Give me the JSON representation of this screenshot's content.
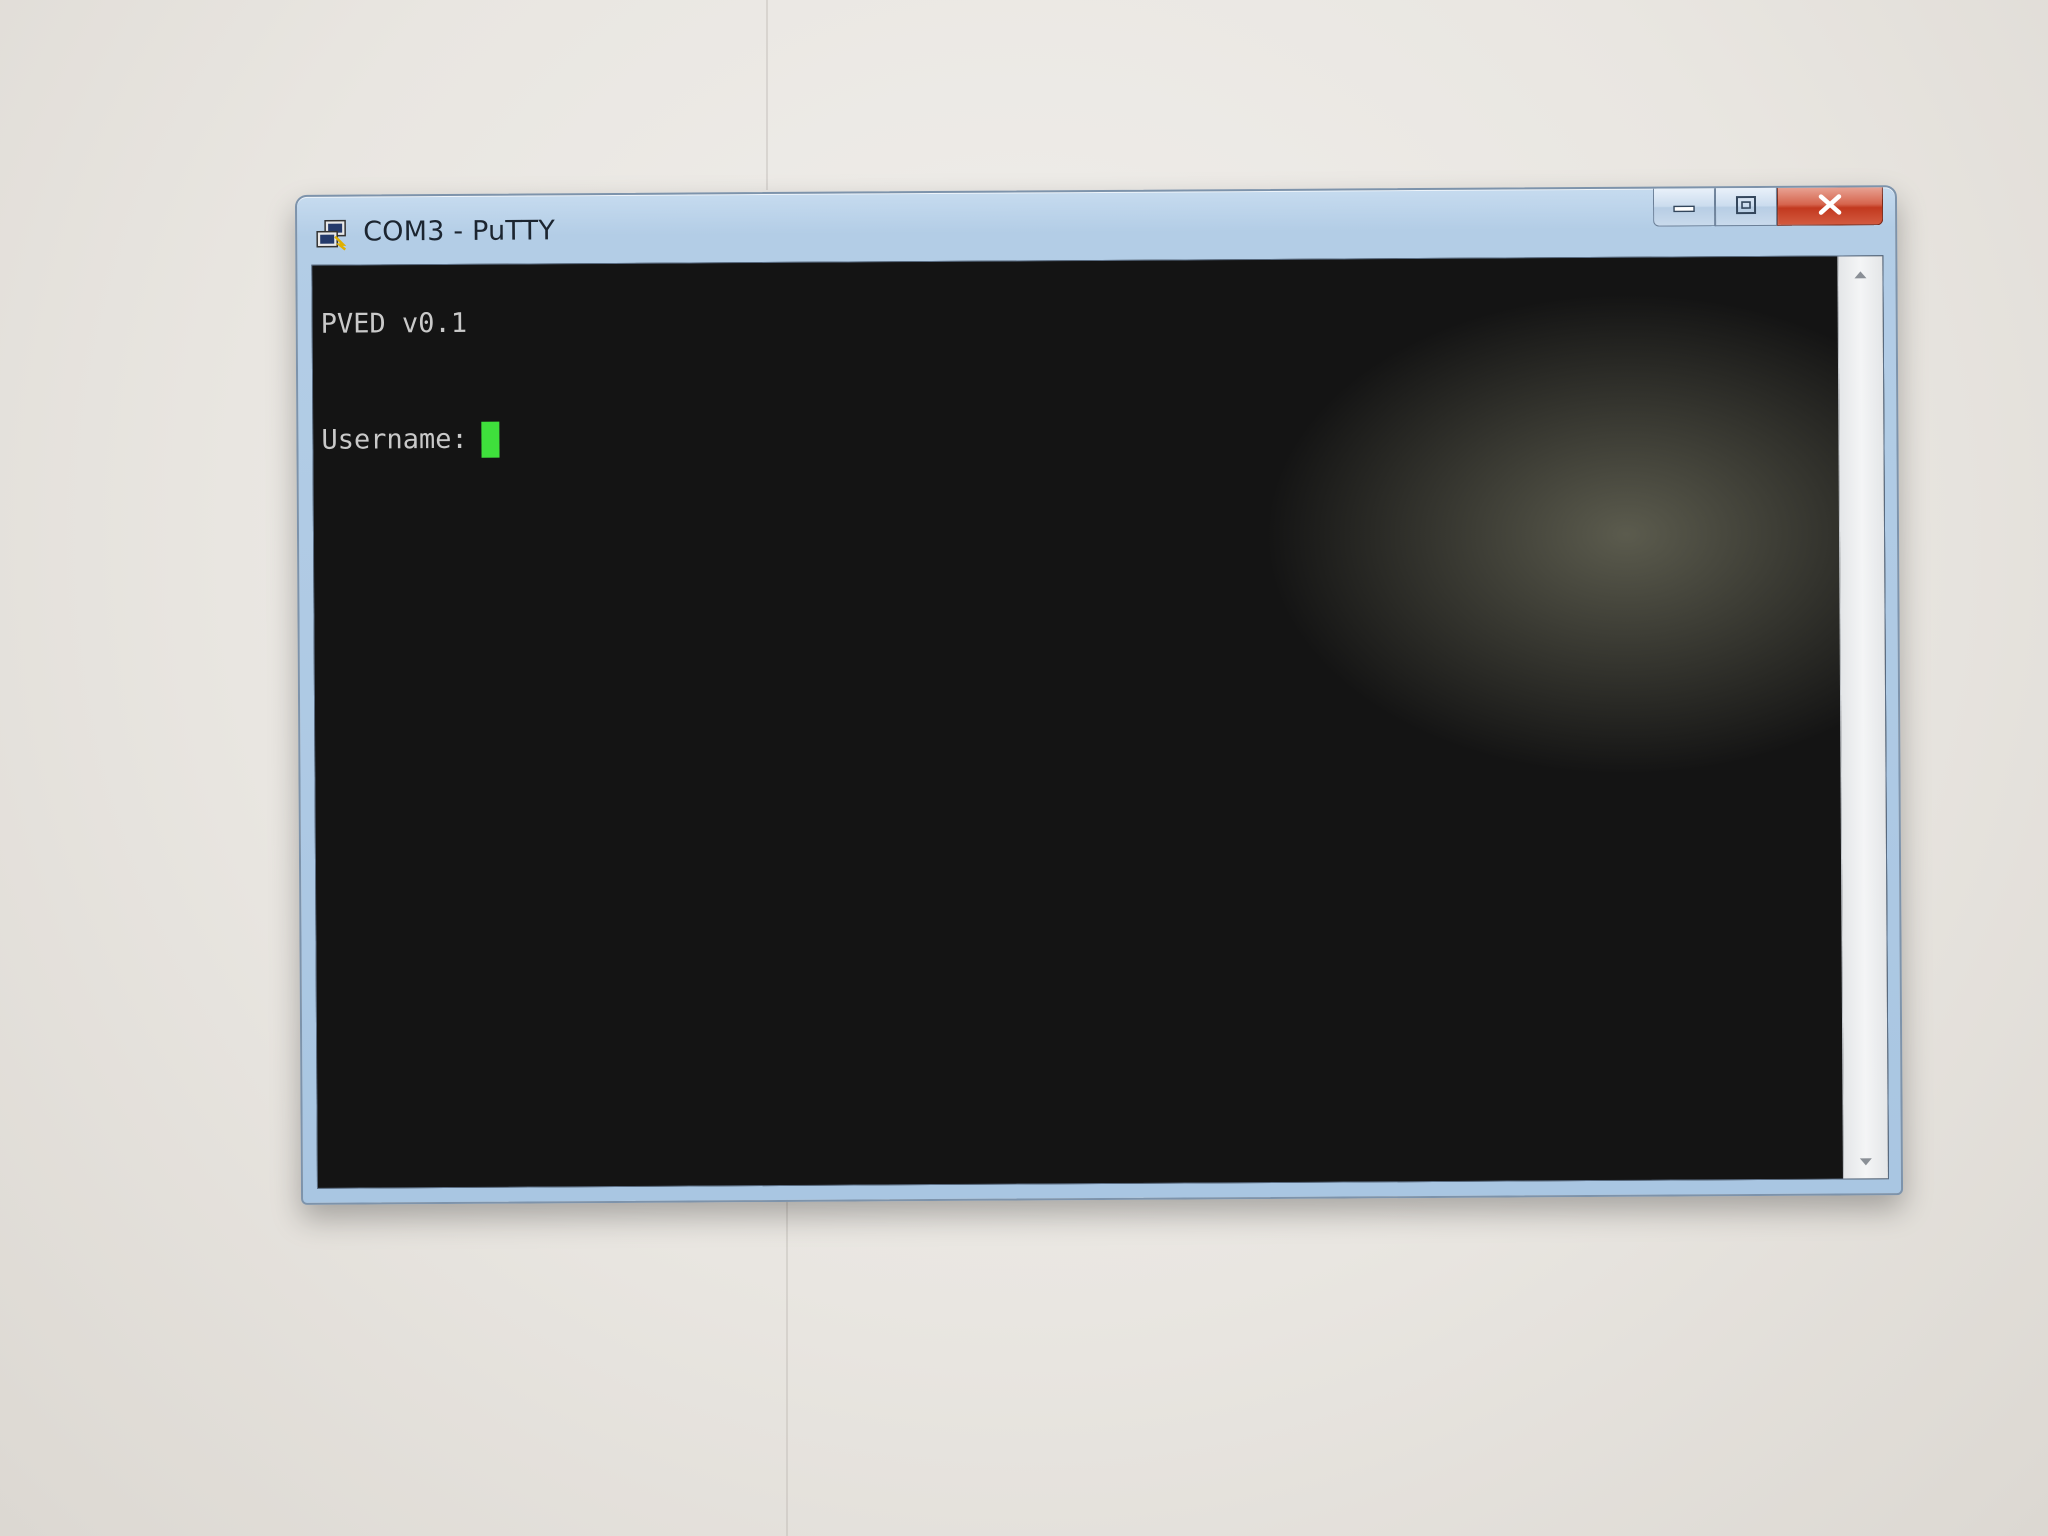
{
  "window": {
    "title": "COM3 - PuTTY",
    "controls": {
      "minimize": "minimize",
      "maximize": "maximize",
      "close": "close"
    }
  },
  "terminal": {
    "banner": "PVED v0.1",
    "prompt": "Username:",
    "input_value": "",
    "cursor_color": "#3fe03c",
    "text_color": "#c9c9c9",
    "background_color": "#141414"
  },
  "icons": {
    "app": "putty-icon",
    "minimize": "minimize-icon",
    "maximize": "maximize-icon",
    "close": "close-icon",
    "scroll_up": "scroll-up-arrow-icon",
    "scroll_down": "scroll-down-arrow-icon"
  }
}
